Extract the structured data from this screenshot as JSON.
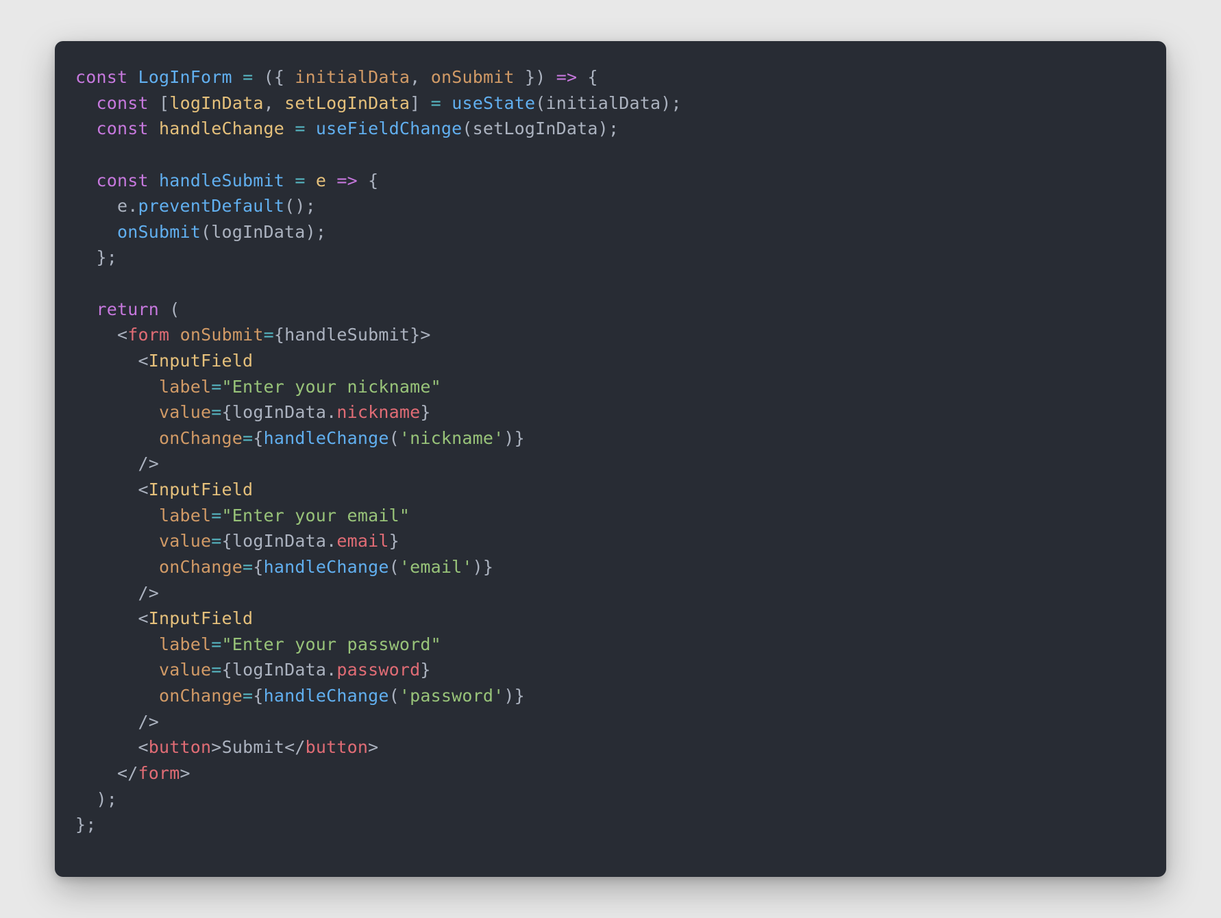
{
  "tokens": {
    "kw_const": "const",
    "kw_return": "return",
    "comp_LogInForm": "LogInForm",
    "param_initialData": "initialData",
    "param_onSubmit": "onSubmit",
    "var_logInData": "logInData",
    "var_setLogInData": "setLogInData",
    "fn_useState": "useState",
    "var_handleChange": "handleChange",
    "fn_useFieldChange": "useFieldChange",
    "var_handleSubmit": "handleSubmit",
    "var_e": "e",
    "fn_preventDefault": "preventDefault",
    "tag_form": "form",
    "tag_InputField": "InputField",
    "tag_button": "button",
    "attr_onSubmit": "onSubmit",
    "attr_label": "label",
    "attr_value": "value",
    "attr_onChange": "onChange",
    "str_nickname_label": "\"Enter your nickname\"",
    "str_email_label": "\"Enter your email\"",
    "str_password_label": "\"Enter your password\"",
    "str_nickname": "'nickname'",
    "str_email": "'email'",
    "str_password": "'password'",
    "prop_nickname": "nickname",
    "prop_email": "email",
    "prop_password": "password",
    "txt_Submit": "Submit",
    "op_eq": "=",
    "op_arrow": "=>",
    "angle_open": "<",
    "angle_open_slash": "</",
    "angle_close": ">",
    "angle_selfclose": "/>",
    "paren_open": "(",
    "paren_close": ")",
    "brace_open": "{",
    "brace_close": "}",
    "bracket_open": "[",
    "bracket_close": "]",
    "comma": ",",
    "dot": ".",
    "semi": ";"
  }
}
